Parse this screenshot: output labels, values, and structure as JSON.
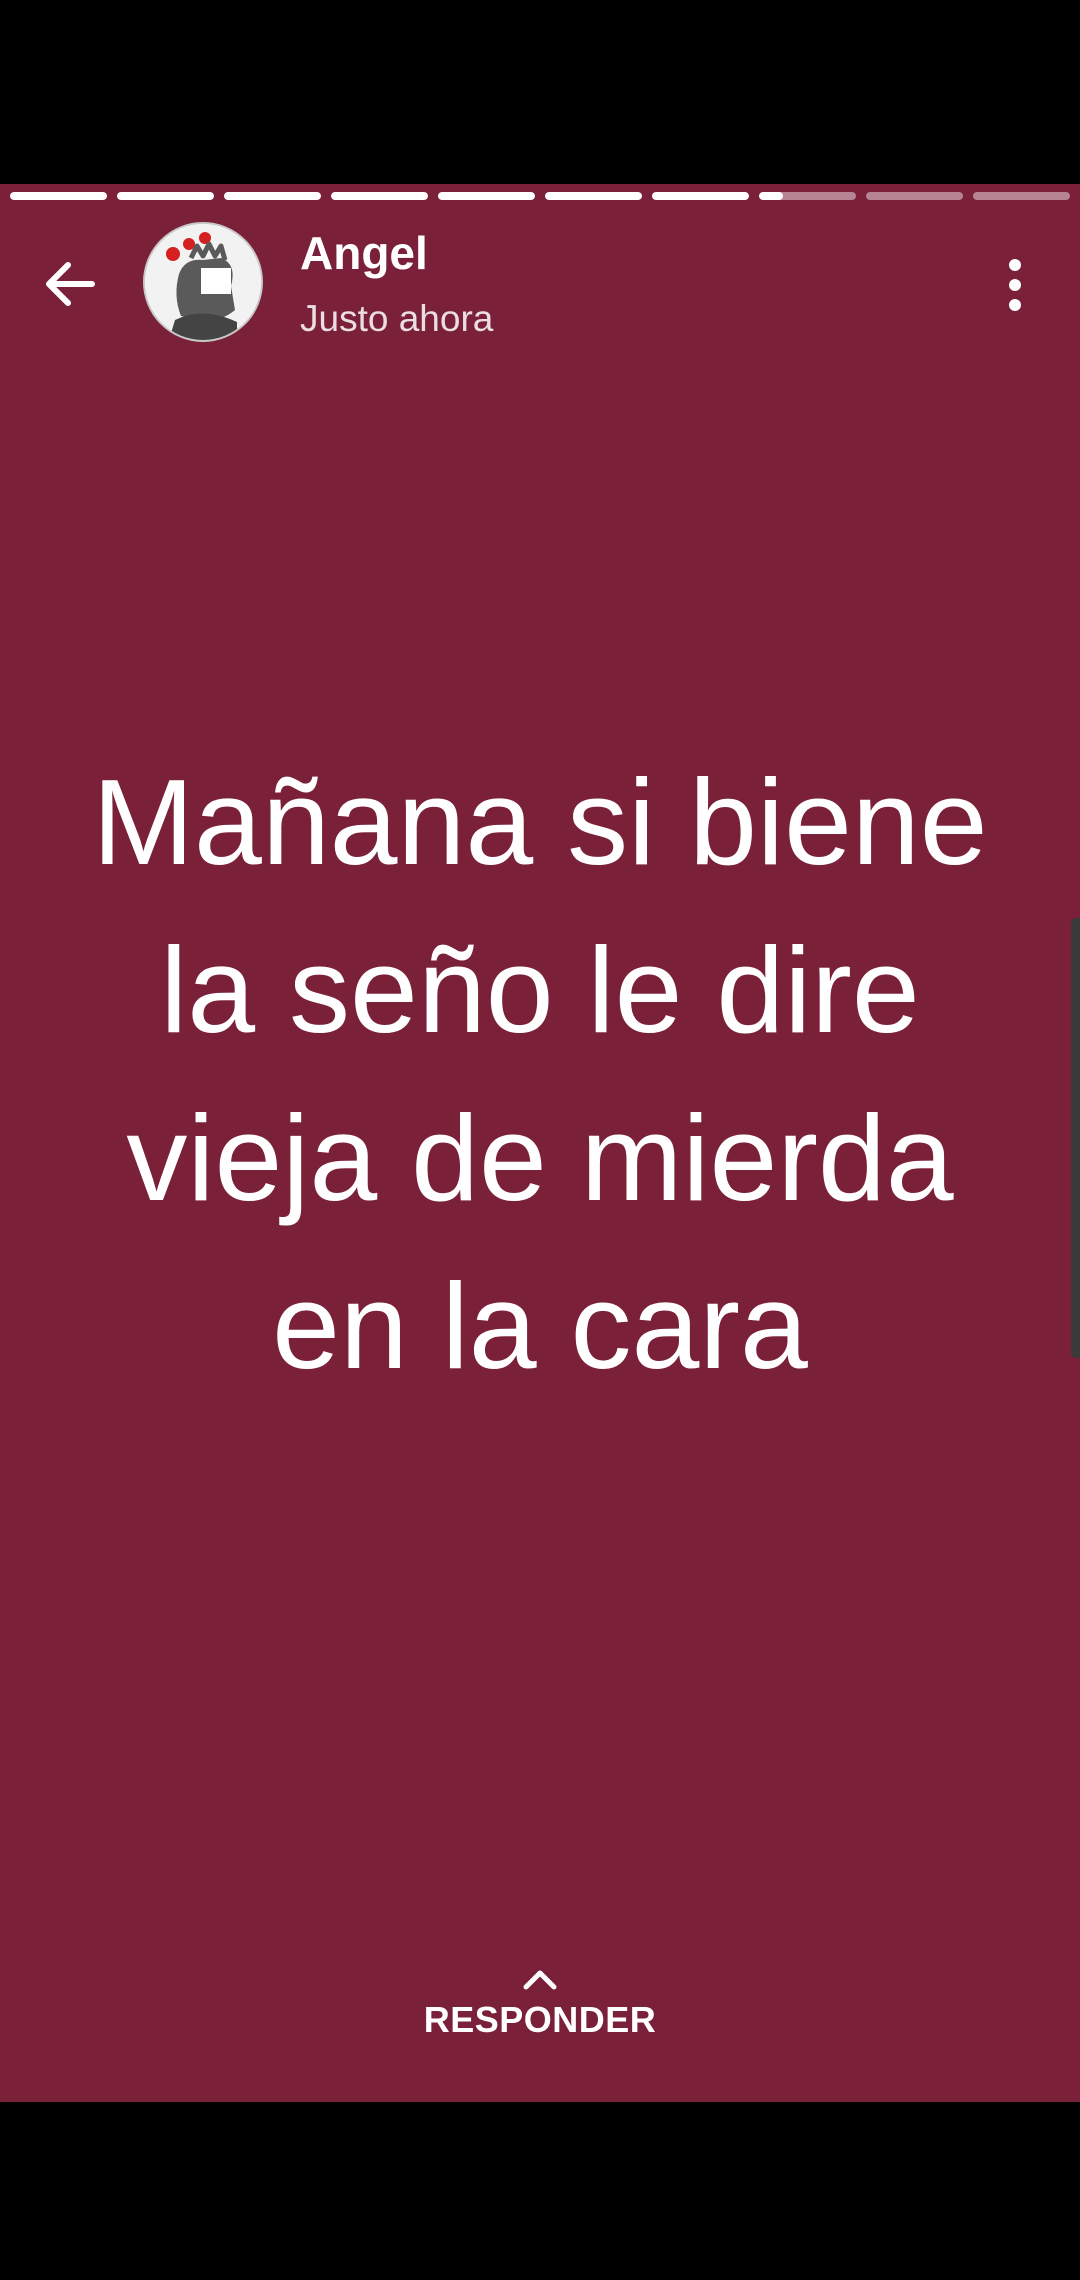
{
  "header": {
    "user_name": "Angel",
    "timestamp": "Justo ahora"
  },
  "progress": {
    "segments": [
      1,
      1,
      1,
      1,
      1,
      1,
      1,
      0.25,
      0,
      0
    ]
  },
  "story": {
    "text": "Mañana si biene la seño le dire vieja de mierda en la cara",
    "background_color": "#7a2039"
  },
  "reply": {
    "label": "RESPONDER"
  }
}
